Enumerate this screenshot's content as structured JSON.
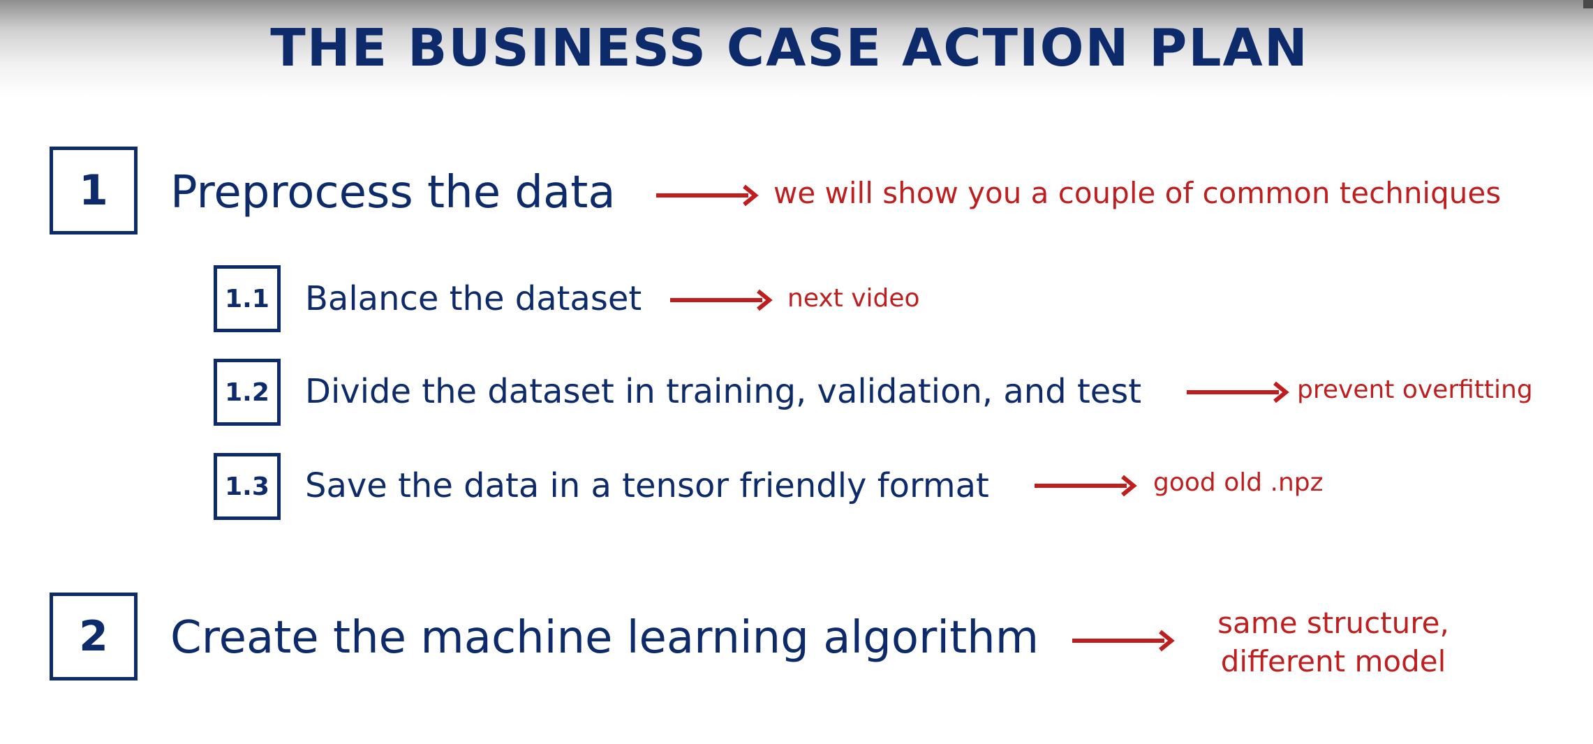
{
  "slide": {
    "title": "THE BUSINESS CASE ACTION PLAN"
  },
  "steps": [
    {
      "number": "1",
      "text": "Preprocess the data",
      "note": "we will show you a couple of common techniques"
    },
    {
      "number": "2",
      "text": "Create the machine learning algorithm",
      "note_lines": [
        "same structure,",
        "different model"
      ]
    }
  ],
  "substeps": [
    {
      "number": "1.1",
      "text": "Balance the dataset",
      "note": "next video"
    },
    {
      "number": "1.2",
      "text": "Divide the dataset in training, validation, and test",
      "note": "prevent overfitting"
    },
    {
      "number": "1.3",
      "text": "Save the data in a tensor friendly format",
      "note": "good old .npz"
    }
  ],
  "colors": {
    "heading": "#0d2a6b",
    "annotation": "#be1e1e"
  },
  "icons": {
    "arrow": "arrow-right-icon"
  }
}
